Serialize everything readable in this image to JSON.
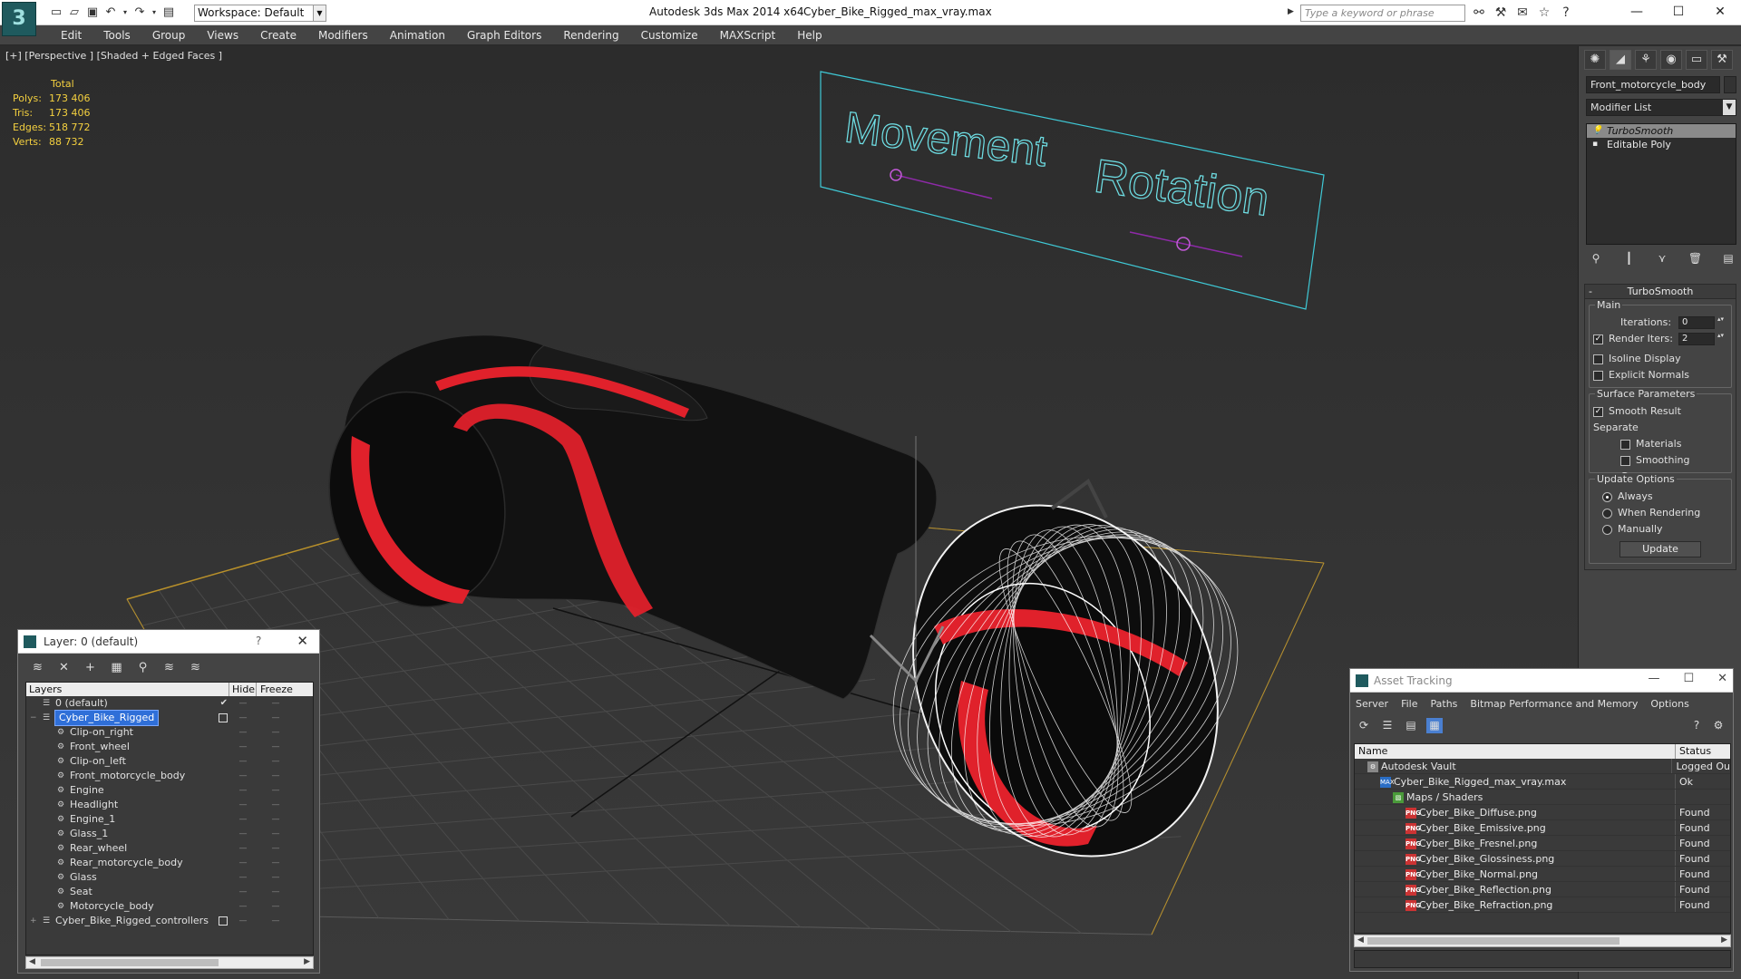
{
  "titlebar": {
    "workspace": "Workspace: Default",
    "app_title": "Autodesk 3ds Max  2014 x64",
    "file_title": "Cyber_Bike_Rigged_max_vray.max",
    "search_placeholder": "Type a keyword or phrase"
  },
  "menu": [
    "Edit",
    "Tools",
    "Group",
    "Views",
    "Create",
    "Modifiers",
    "Animation",
    "Graph Editors",
    "Rendering",
    "Customize",
    "MAXScript",
    "Help"
  ],
  "viewport": {
    "label": "[+] [Perspective ] [Shaded + Edged Faces ]",
    "stats_header": "Total",
    "stats": [
      {
        "label": "Polys:",
        "value": "173 406"
      },
      {
        "label": "Tris:",
        "value": "173 406"
      },
      {
        "label": "Edges:",
        "value": "518 772"
      },
      {
        "label": "Verts:",
        "value": "88 732"
      }
    ],
    "rig_labels": {
      "movement": "Movement",
      "rotation": "Rotation"
    }
  },
  "command_panel": {
    "object_name": "Front_motorcycle_body",
    "modifier_list": "Modifier List",
    "stack": [
      "TurboSmooth",
      "Editable Poly"
    ],
    "rollout_title": "TurboSmooth",
    "main": {
      "title": "Main",
      "iterations_label": "Iterations:",
      "iterations_value": "0",
      "render_iters_label": "Render Iters:",
      "render_iters_value": "2",
      "isoline": "Isoline Display",
      "explicit": "Explicit Normals"
    },
    "surface": {
      "title": "Surface Parameters",
      "smooth": "Smooth Result",
      "separate": "Separate",
      "materials": "Materials",
      "smoothing_groups": "Smoothing Groups"
    },
    "update": {
      "title": "Update Options",
      "always": "Always",
      "when_rendering": "When Rendering",
      "manually": "Manually",
      "button": "Update"
    }
  },
  "layer_dialog": {
    "title": "Layer: 0 (default)",
    "help": "?",
    "columns": [
      "Layers",
      "Hide",
      "Freeze"
    ],
    "rows": [
      {
        "name": "0 (default)",
        "level": 0
      },
      {
        "name": "Cyber_Bike_Rigged",
        "level": 0
      },
      {
        "name": "Clip-on_right",
        "level": 1
      },
      {
        "name": "Front_wheel",
        "level": 1
      },
      {
        "name": "Clip-on_left",
        "level": 1
      },
      {
        "name": "Front_motorcycle_body",
        "level": 1
      },
      {
        "name": "Engine",
        "level": 1
      },
      {
        "name": "Headlight",
        "level": 1
      },
      {
        "name": "Engine_1",
        "level": 1
      },
      {
        "name": "Glass_1",
        "level": 1
      },
      {
        "name": "Rear_wheel",
        "level": 1
      },
      {
        "name": "Rear_motorcycle_body",
        "level": 1
      },
      {
        "name": "Glass",
        "level": 1
      },
      {
        "name": "Seat",
        "level": 1
      },
      {
        "name": "Motorcycle_body",
        "level": 1
      },
      {
        "name": "Cyber_Bike_Rigged_controllers",
        "level": 0
      }
    ]
  },
  "asset_tracking": {
    "title": "Asset Tracking",
    "menu": [
      "Server",
      "File",
      "Paths",
      "Bitmap Performance and Memory",
      "Options"
    ],
    "columns": [
      "Name",
      "Status"
    ],
    "rows": [
      {
        "name": "Autodesk Vault",
        "status": "Logged Ou",
        "indent": 1,
        "icon": "vault"
      },
      {
        "name": "Cyber_Bike_Rigged_max_vray.max",
        "status": "Ok",
        "indent": 2,
        "icon": "max"
      },
      {
        "name": "Maps / Shaders",
        "status": "",
        "indent": 3,
        "icon": "maps"
      },
      {
        "name": "Cyber_Bike_Diffuse.png",
        "status": "Found",
        "indent": 4,
        "icon": "png"
      },
      {
        "name": "Cyber_Bike_Emissive.png",
        "status": "Found",
        "indent": 4,
        "icon": "png"
      },
      {
        "name": "Cyber_Bike_Fresnel.png",
        "status": "Found",
        "indent": 4,
        "icon": "png"
      },
      {
        "name": "Cyber_Bike_Glossiness.png",
        "status": "Found",
        "indent": 4,
        "icon": "png"
      },
      {
        "name": "Cyber_Bike_Normal.png",
        "status": "Found",
        "indent": 4,
        "icon": "png"
      },
      {
        "name": "Cyber_Bike_Reflection.png",
        "status": "Found",
        "indent": 4,
        "icon": "png"
      },
      {
        "name": "Cyber_Bike_Refraction.png",
        "status": "Found",
        "indent": 4,
        "icon": "png"
      }
    ]
  },
  "colors": {
    "accent_red": "#e0212b",
    "stats_yellow": "#f4d03f",
    "selection_blue": "#2f6fd8",
    "rig_cyan": "#3fc9d6"
  }
}
